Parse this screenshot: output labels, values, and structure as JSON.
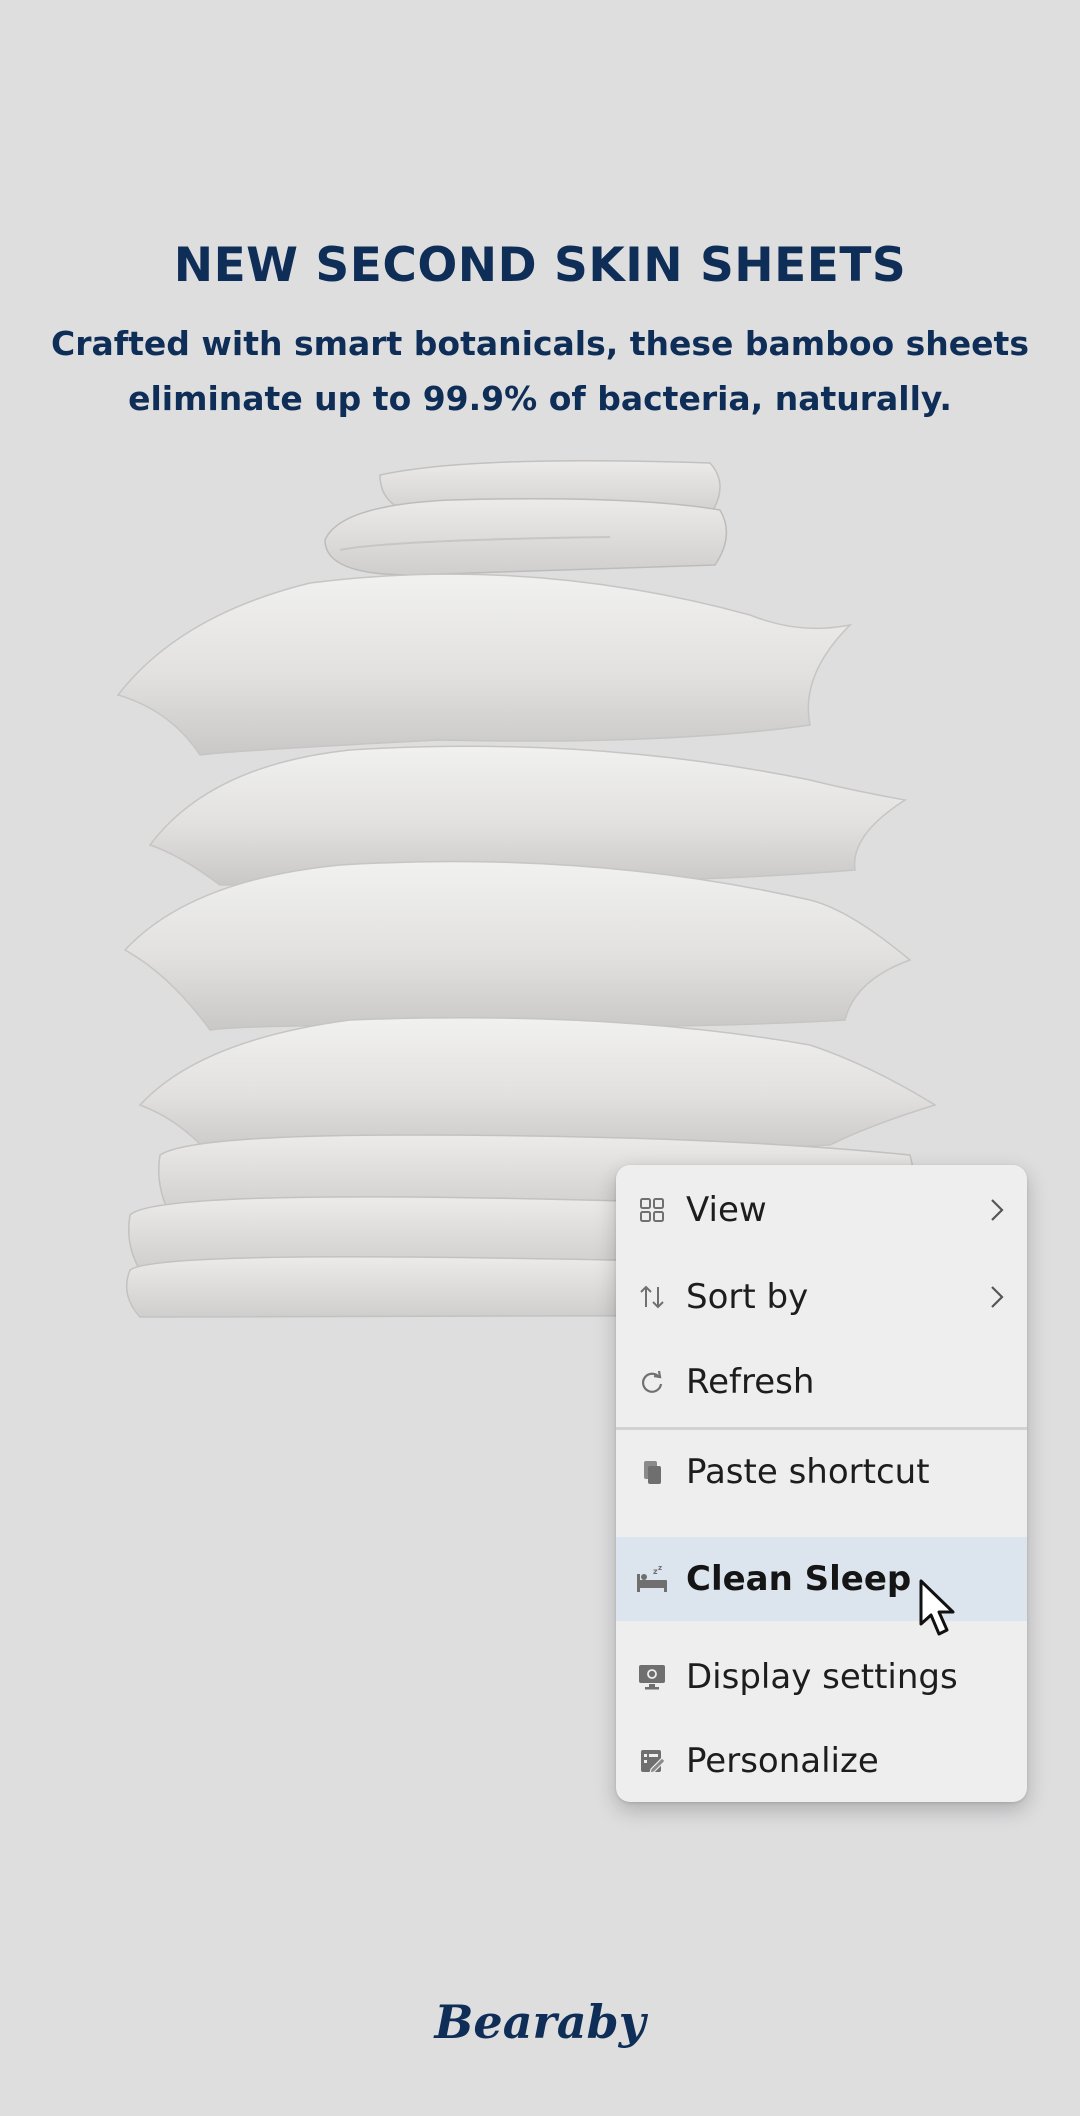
{
  "ad": {
    "headline": "NEW SECOND SKIN SHEETS",
    "subheadline": "Crafted with smart botanicals, these bamboo sheets eliminate up to 99.9% of bacteria, naturally.",
    "brand_logo_text": "Bearaby",
    "brand_color": "#0f2e57"
  },
  "context_menu": {
    "items": [
      {
        "label": "View",
        "icon": "grid-icon",
        "has_submenu": true
      },
      {
        "label": "Sort by",
        "icon": "sort-arrows-icon",
        "has_submenu": true
      },
      {
        "label": "Refresh",
        "icon": "refresh-icon",
        "has_submenu": false
      },
      {
        "label": "Paste shortcut",
        "icon": "paste-icon",
        "has_submenu": false
      },
      {
        "label": "Clean Sleep",
        "icon": "sleep-bed-icon",
        "has_submenu": false,
        "highlighted": true
      },
      {
        "label": "Display settings",
        "icon": "monitor-settings-icon",
        "has_submenu": false
      },
      {
        "label": "Personalize",
        "icon": "personalize-icon",
        "has_submenu": false
      }
    ],
    "highlight_color": "#dce5ee"
  }
}
